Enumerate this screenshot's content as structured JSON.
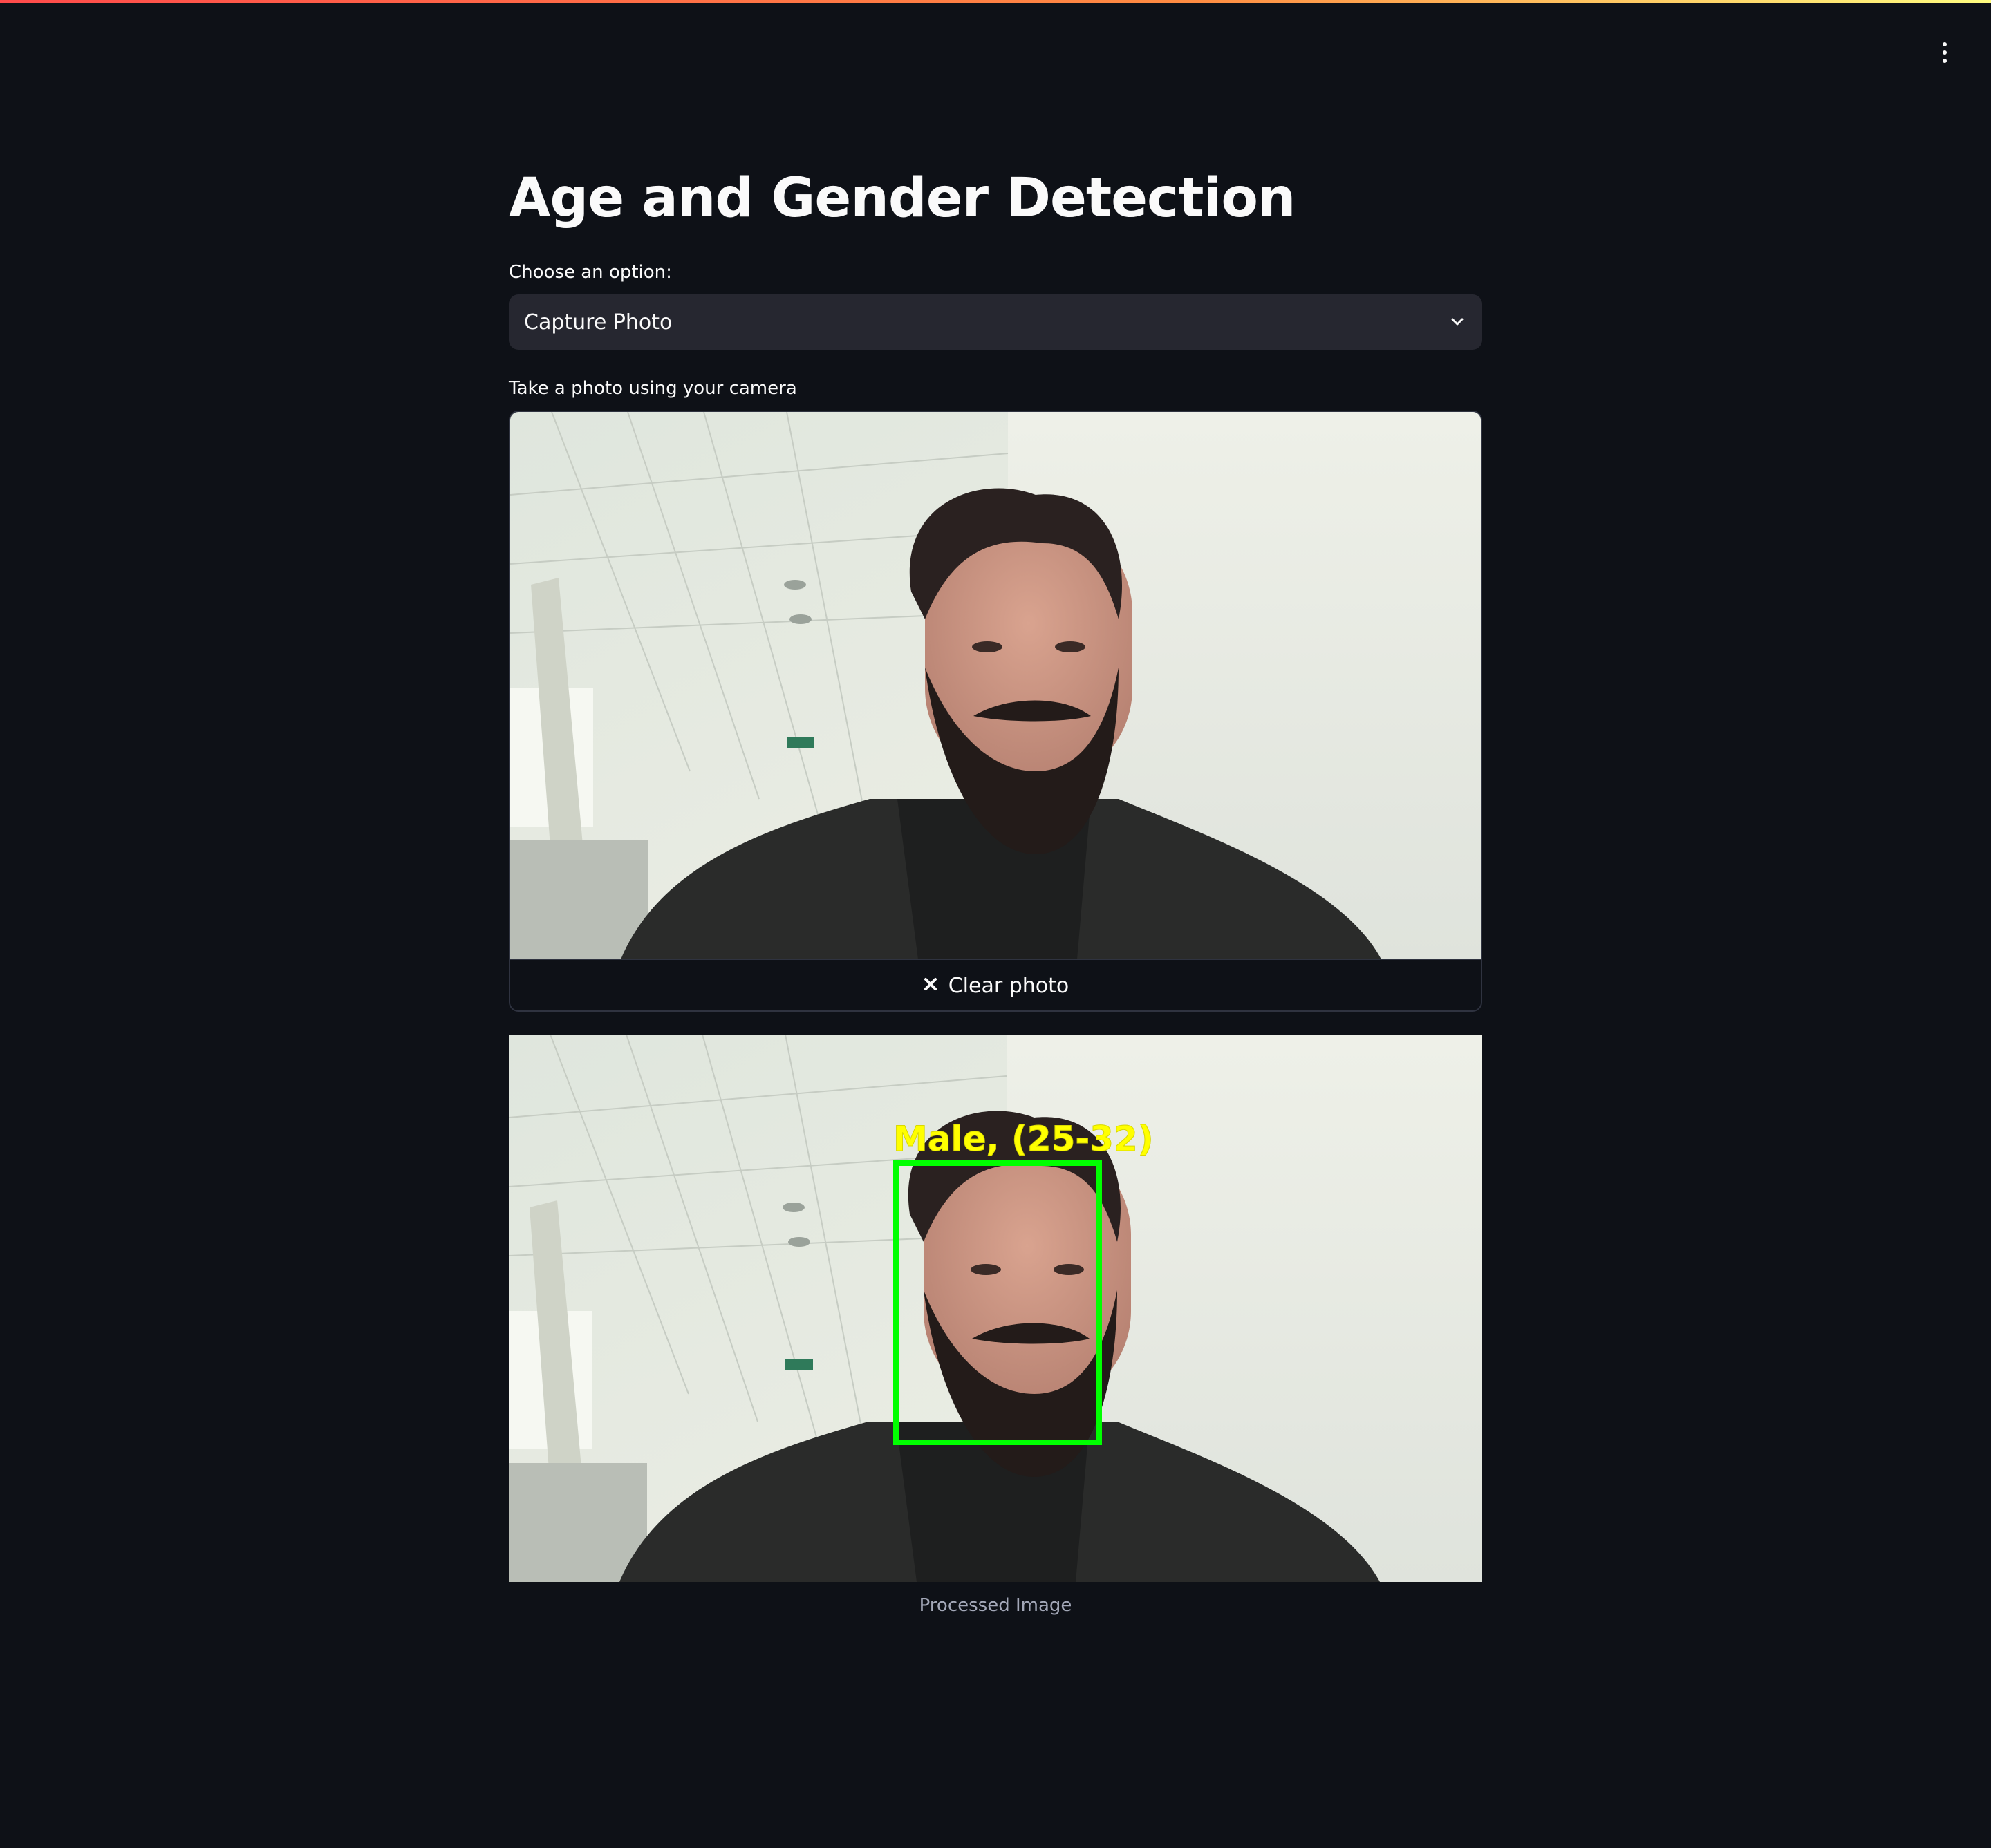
{
  "app": {
    "title": "Age and Gender Detection"
  },
  "header": {
    "menu_icon": "vertical-dots-icon"
  },
  "selector": {
    "label": "Choose an option:",
    "value": "Capture Photo",
    "icon": "chevron-down-icon"
  },
  "camera": {
    "label": "Take a photo using your camera",
    "clear_label": "Clear photo",
    "clear_icon": "close-icon"
  },
  "result": {
    "detection_label": "Male, (25-32)",
    "caption": "Processed Image",
    "box_color": "#00ff00",
    "label_color": "#ffff00"
  },
  "colors": {
    "background": "#0e1117",
    "select_bg": "#262730",
    "text": "#fafafa",
    "caption": "#a3a8b8"
  }
}
